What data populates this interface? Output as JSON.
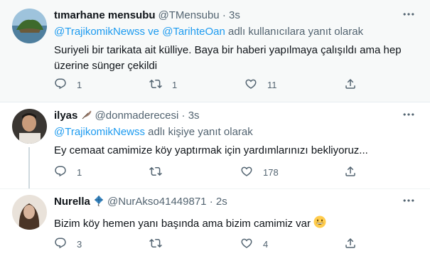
{
  "tweets": [
    {
      "name": "tımarhane mensubu",
      "handle": "@TMensubu",
      "dot": "·",
      "time": "3s",
      "reply_mention_1": "@TrajikomikNewss",
      "reply_joiner": " ve ",
      "reply_mention_2": "@TarihteOan",
      "reply_suffix": " adlı kullanıcılara yanıt olarak",
      "text_line1": "Suriyeli bir tarikata ait külliye. Baya bir haberi yapılmaya çalışıldı ama hep",
      "text_line2": "üzerine sünger çekildi",
      "replies": "1",
      "retweets": "1",
      "likes": "11"
    },
    {
      "name": "ilyas",
      "handle": "@donmaderecesi",
      "dot": "·",
      "time": "3s",
      "reply_mention_1": "@TrajikomikNewss",
      "reply_suffix": " adlı kişiye yanıt olarak",
      "text_line1": "Ey cemaat camimize köy yaptırmak için yardımlarınızı bekliyoruz...",
      "replies": "1",
      "retweets": "",
      "likes": "178"
    },
    {
      "name": "Nurella",
      "handle": "@NurAkso41449871",
      "dot": "·",
      "time": "2s",
      "text_line1": "Bizim köy hemen yanı başında ama bizim camimiz var",
      "replies": "3",
      "retweets": "",
      "likes": "4"
    }
  ],
  "icons": {
    "more": "more-icon",
    "reply": "reply-icon",
    "retweet": "retweet-icon",
    "like": "like-icon",
    "share": "share-icon",
    "name_badge_1": "feather-icon",
    "name_badge_2": "kite-icon",
    "emoji": "grinning-face-icon"
  },
  "colors": {
    "link": "#1d9bf0",
    "muted": "#536471",
    "text": "#0f1419",
    "highlight_bg": "#f7f9f9"
  }
}
